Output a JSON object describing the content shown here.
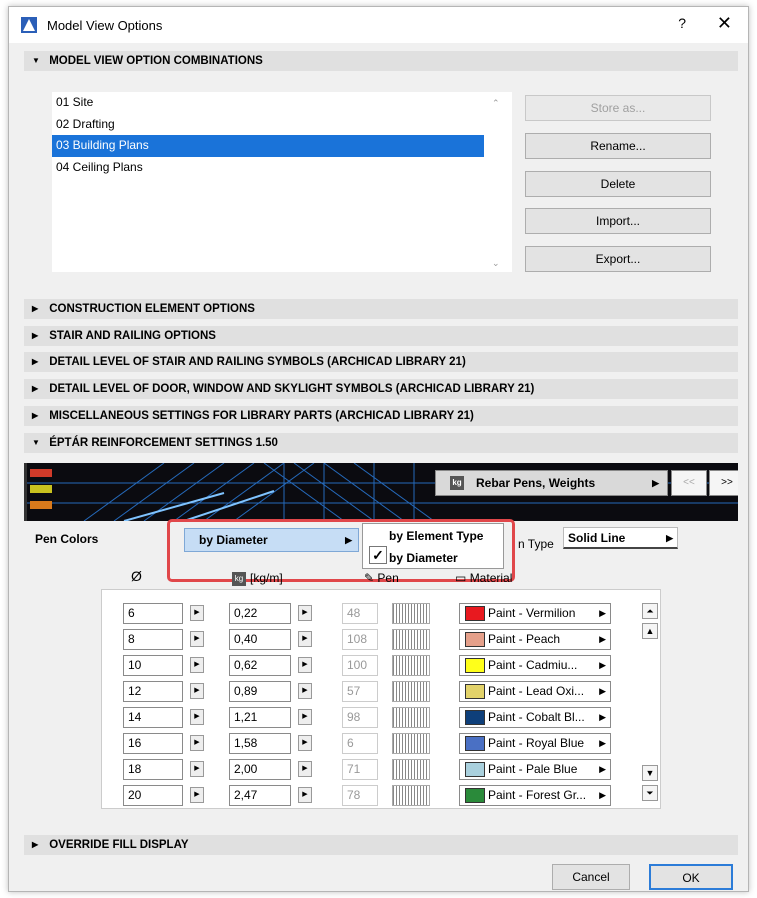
{
  "window": {
    "title": "Model View Options",
    "help": "?",
    "close": "✕"
  },
  "sections": {
    "combos": "MODEL VIEW OPTION COMBINATIONS",
    "construction": "CONSTRUCTION ELEMENT OPTIONS",
    "stair": "STAIR AND RAILING OPTIONS",
    "detail_stair": "DETAIL LEVEL OF STAIR AND RAILING SYMBOLS (ARCHICAD LIBRARY 21)",
    "detail_door": "DETAIL LEVEL OF DOOR, WINDOW AND SKYLIGHT SYMBOLS (ARCHICAD LIBRARY 21)",
    "misc": "MISCELLANEOUS SETTINGS FOR LIBRARY PARTS (ARCHICAD LIBRARY 21)",
    "eptar": "ÉPTÁR REINFORCEMENT SETTINGS 1.50",
    "override": "OVERRIDE FILL DISPLAY"
  },
  "combos": {
    "items": [
      "01 Site",
      "02 Drafting",
      "03 Building Plans",
      "04 Ceiling Plans"
    ],
    "selected_index": 2,
    "buttons": {
      "store": "Store as...",
      "rename": "Rename...",
      "delete": "Delete",
      "import": "Import...",
      "export": "Export..."
    }
  },
  "banner": {
    "rebar_label": "Rebar Pens, Weights",
    "prev": "<<",
    "next": ">>"
  },
  "pen": {
    "label": "Pen Colors",
    "selected": "by Diameter",
    "menu": [
      "by Element Type",
      "by Diameter"
    ],
    "type_label": "n Type",
    "line_type": "Solid Line"
  },
  "columns": {
    "diameter": "Ø",
    "weight": "[kg/m]",
    "pen": "Pen",
    "material": "Material"
  },
  "rows": [
    {
      "diameter": "6",
      "weight": "0,22",
      "pen": "48",
      "material": "Paint - Vermilion",
      "color": "#e8191f"
    },
    {
      "diameter": "8",
      "weight": "0,40",
      "pen": "108",
      "material": "Paint - Peach",
      "color": "#e5a08a"
    },
    {
      "diameter": "10",
      "weight": "0,62",
      "pen": "100",
      "material": "Paint - Cadmiu...",
      "color": "#ffff1a"
    },
    {
      "diameter": "12",
      "weight": "0,89",
      "pen": "57",
      "material": "Paint - Lead Oxi...",
      "color": "#e3d36a"
    },
    {
      "diameter": "14",
      "weight": "1,21",
      "pen": "98",
      "material": "Paint - Cobalt Bl...",
      "color": "#0e3f7a"
    },
    {
      "diameter": "16",
      "weight": "1,58",
      "pen": "6",
      "material": "Paint - Royal Blue",
      "color": "#4a70c4"
    },
    {
      "diameter": "18",
      "weight": "2,00",
      "pen": "71",
      "material": "Paint - Pale Blue",
      "color": "#a9d0dd"
    },
    {
      "diameter": "20",
      "weight": "2,47",
      "pen": "78",
      "material": "Paint - Forest Gr...",
      "color": "#2a8a3a"
    }
  ],
  "footer": {
    "cancel": "Cancel",
    "ok": "OK"
  },
  "colors": {
    "selection": "#1a73d9",
    "highlight_outline": "#e0474a",
    "header_bg": "#e0e0e0"
  }
}
